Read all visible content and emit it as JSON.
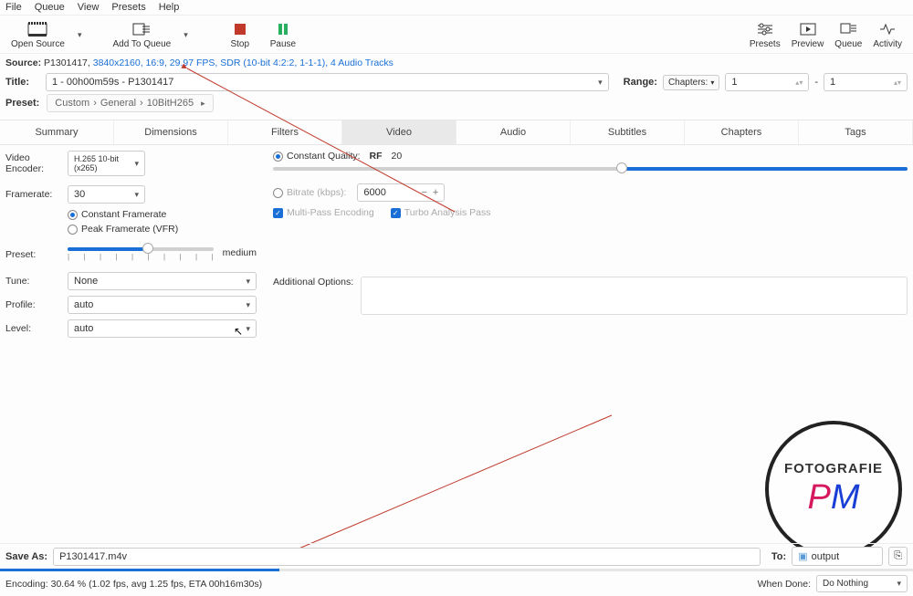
{
  "menu": {
    "items": [
      "File",
      "Queue",
      "View",
      "Presets",
      "Help"
    ]
  },
  "toolbar": {
    "open": "Open Source",
    "add": "Add To Queue",
    "stop": "Stop",
    "pause": "Pause",
    "presets": "Presets",
    "preview": "Preview",
    "queue": "Queue",
    "activity": "Activity"
  },
  "source": {
    "label": "Source:",
    "black": "P1301417, ",
    "blue": "3840x2160, 16:9, 29.97 FPS, SDR (10-bit 4:2:2, 1-1-1), 4 Audio Tracks"
  },
  "title": {
    "label": "Title:",
    "value": "1 - 00h00m59s - P1301417",
    "range": "Range:",
    "rangeType": "Chapters:",
    "from": "1",
    "to": "1",
    "dash": "-"
  },
  "preset": {
    "label": "Preset:",
    "path": [
      "Custom",
      "General",
      "10BitH265"
    ]
  },
  "tabs": [
    "Summary",
    "Dimensions",
    "Filters",
    "Video",
    "Audio",
    "Subtitles",
    "Chapters",
    "Tags"
  ],
  "video": {
    "encoderLbl": "Video Encoder:",
    "encoder": "H.265 10-bit (x265)",
    "framerateLbl": "Framerate:",
    "framerate": "30",
    "constFr": "Constant Framerate",
    "peakFr": "Peak Framerate (VFR)",
    "cq": "Constant Quality:",
    "rf": "RF",
    "rfVal": "20",
    "bitrate": "Bitrate (kbps):",
    "bitrateVal": "6000",
    "multipass": "Multi-Pass Encoding",
    "turbo": "Turbo Analysis Pass",
    "presetLbl": "Preset:",
    "presetVal": "medium",
    "tuneLbl": "Tune:",
    "tune": "None",
    "profileLbl": "Profile:",
    "profile": "auto",
    "levelLbl": "Level:",
    "level": "auto",
    "addOpt": "Additional Options:"
  },
  "save": {
    "label": "Save As:",
    "value": "P1301417.m4v",
    "to": "To:",
    "dest": "output"
  },
  "status": {
    "text": "Encoding: 30.64 % (1.02 fps, avg 1.25 fps, ETA 00h16m30s)",
    "whenDone": "When Done:",
    "action": "Do Nothing"
  },
  "watermark": {
    "top": "FOTOGRAFIE",
    "p": "P",
    "m": "M"
  }
}
